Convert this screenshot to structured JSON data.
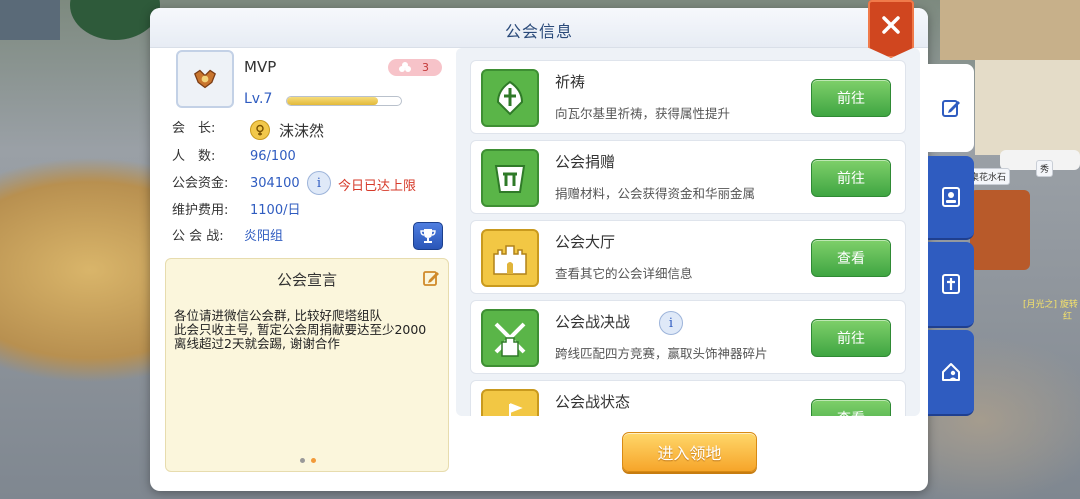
{
  "dialog": {
    "title": "公会信息"
  },
  "guild": {
    "name": "MVP",
    "rank": "3",
    "level": "Lv.7",
    "level_progress": 0.8,
    "rows": [
      {
        "label": "会　长:",
        "value": ""
      },
      {
        "label": "人　数:",
        "value": "96/100"
      },
      {
        "label": "公会资金:",
        "value": "304100"
      },
      {
        "label": "维护费用:",
        "value": "1100/日"
      },
      {
        "label": "公 会 战:",
        "value": "炎阳组"
      }
    ],
    "leader_name": "沫沫然",
    "funds_status": "今日已达上限"
  },
  "manifesto": {
    "title": "公会宣言",
    "text": "各位请进微信公会群, 比较好爬塔组队\n此会只收主号, 暂定公会周捐献要达至少2000\n离线超过2天就会踢, 谢谢合作"
  },
  "features": [
    {
      "title": "祈祷",
      "desc": "向瓦尔基里祈祷，获得属性提升",
      "button": "前往"
    },
    {
      "title": "公会捐赠",
      "desc": "捐赠材料，公会获得资金和华丽金属",
      "button": "前往"
    },
    {
      "title": "公会大厅",
      "desc": "查看其它的公会详细信息",
      "button": "查看"
    },
    {
      "title": "公会战决战",
      "desc": "跨线匹配四方竞赛，赢取头饰神器碎片",
      "button": "前往"
    },
    {
      "title": "公会战状态",
      "desc": "",
      "button": "查看"
    }
  ],
  "enter_button": "进入领地",
  "background_labels": [
    "桌花水石",
    "秀",
    "[月光之] 旋转",
    "红"
  ],
  "colors": {
    "accent_blue": "#2f5cc0",
    "button_green": "#3fa542",
    "close_red": "#d0461f",
    "limit_red": "#d63a2a"
  }
}
